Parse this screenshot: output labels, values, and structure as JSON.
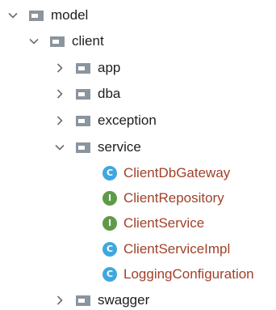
{
  "tree": {
    "nodes": [
      {
        "label": "model",
        "kind": "package",
        "expanded": true
      },
      {
        "label": "client",
        "kind": "package",
        "expanded": true
      },
      {
        "label": "app",
        "kind": "package",
        "expanded": false
      },
      {
        "label": "dba",
        "kind": "package",
        "expanded": false
      },
      {
        "label": "exception",
        "kind": "package",
        "expanded": false
      },
      {
        "label": "service",
        "kind": "package",
        "expanded": true
      },
      {
        "label": "ClientDbGateway",
        "kind": "class",
        "badge": "C"
      },
      {
        "label": "ClientRepository",
        "kind": "interface",
        "badge": "I"
      },
      {
        "label": "ClientService",
        "kind": "interface",
        "badge": "I"
      },
      {
        "label": "ClientServiceImpl",
        "kind": "class",
        "badge": "C"
      },
      {
        "label": "LoggingConfiguration",
        "kind": "class",
        "badge": "C"
      },
      {
        "label": "swagger",
        "kind": "package",
        "expanded": false
      }
    ]
  },
  "colors": {
    "class_badge": "#3fa7e0",
    "interface_badge": "#5f9a48",
    "class_label": "#a0412a",
    "folder": "#8a959e",
    "chevron": "#6e6e6e"
  },
  "icons": {
    "expanded": "chevron-down-icon",
    "collapsed": "chevron-right-icon",
    "package": "package-folder-icon",
    "class": "class-icon",
    "interface": "interface-icon"
  }
}
